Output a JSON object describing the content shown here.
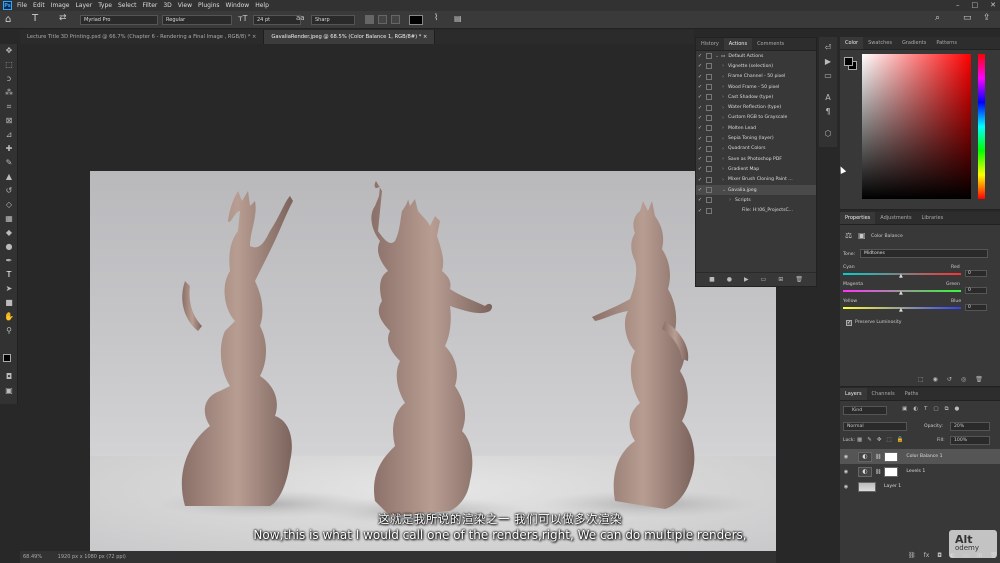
{
  "app": {
    "logo": "Ps"
  },
  "menu": [
    "File",
    "Edit",
    "Image",
    "Layer",
    "Type",
    "Select",
    "Filter",
    "3D",
    "View",
    "Plugins",
    "Window",
    "Help"
  ],
  "options": {
    "font_family": "Myriad Pro",
    "font_style": "Regular",
    "font_size": "24 pt",
    "antialias": "Sharp",
    "text_color": "#000000"
  },
  "tabs": [
    {
      "label": "Lecture Title 3D Printing.psd @ 66.7% (Chapter 6 - Rendering a Final Image , RGB/8) *",
      "active": false
    },
    {
      "label": "GavaliaRender.jpeg @ 68.5% (Color Balance 1, RGB/8#) *",
      "active": true
    }
  ],
  "status": {
    "zoom": "68.49%",
    "doc": "1920 px x 1080 px (72 ppi)"
  },
  "actions_panel": {
    "tabs": [
      "History",
      "Actions",
      "Comments"
    ],
    "active_tab": "Actions",
    "items": [
      {
        "label": "Default Actions",
        "level": 0
      },
      {
        "label": "Vignette (selection)",
        "level": 1
      },
      {
        "label": "Frame Channel - 50 pixel",
        "level": 1
      },
      {
        "label": "Wood Frame - 50 pixel",
        "level": 1
      },
      {
        "label": "Cast Shadow (type)",
        "level": 1
      },
      {
        "label": "Water Reflection (type)",
        "level": 1
      },
      {
        "label": "Custom RGB to Grayscale",
        "level": 1
      },
      {
        "label": "Molten Lead",
        "level": 1
      },
      {
        "label": "Sepia Toning (layer)",
        "level": 1
      },
      {
        "label": "Quadrant Colors",
        "level": 1
      },
      {
        "label": "Save as Photoshop PDF",
        "level": 1
      },
      {
        "label": "Gradient Map",
        "level": 1
      },
      {
        "label": "Mixer Brush Cloning Paint ...",
        "level": 1
      },
      {
        "label": "Gavalia.jpeg",
        "level": 1,
        "selected": true
      },
      {
        "label": "Scripts",
        "level": 2
      },
      {
        "label": "File: H:\\06_ProjectsC...",
        "level": 3
      }
    ]
  },
  "color_panel": {
    "tabs": [
      "Color",
      "Swatches",
      "Gradients",
      "Patterns"
    ],
    "active_tab": "Color"
  },
  "properties": {
    "tabs": [
      "Properties",
      "Adjustments",
      "Libraries"
    ],
    "title": "Color Balance",
    "tone_label": "Tone:",
    "tone_value": "Midtones",
    "sliders": [
      {
        "left": "Cyan",
        "right": "Red",
        "value": "0"
      },
      {
        "left": "Magenta",
        "right": "Green",
        "value": "0"
      },
      {
        "left": "Yellow",
        "right": "Blue",
        "value": "0"
      }
    ],
    "preserve": "Preserve Luminosity"
  },
  "layers": {
    "tabs": [
      "Layers",
      "Channels",
      "Paths"
    ],
    "filter": "Kind",
    "blend": "Normal",
    "opacity_label": "Opacity:",
    "opacity": "20%",
    "lock_label": "Lock:",
    "fill_label": "Fill:",
    "fill": "100%",
    "items": [
      {
        "name": "Color Balance 1",
        "selected": true
      },
      {
        "name": "Levels 1",
        "selected": false
      },
      {
        "name": "Layer 1",
        "selected": false
      }
    ]
  },
  "subtitle": {
    "zh": "这就是我所说的渲染之一 我们可以做多次渲染",
    "en": "Now,this is what I would call one of the renders,right, We can do multiple renders,"
  },
  "watermark": "Alt\nodemy"
}
